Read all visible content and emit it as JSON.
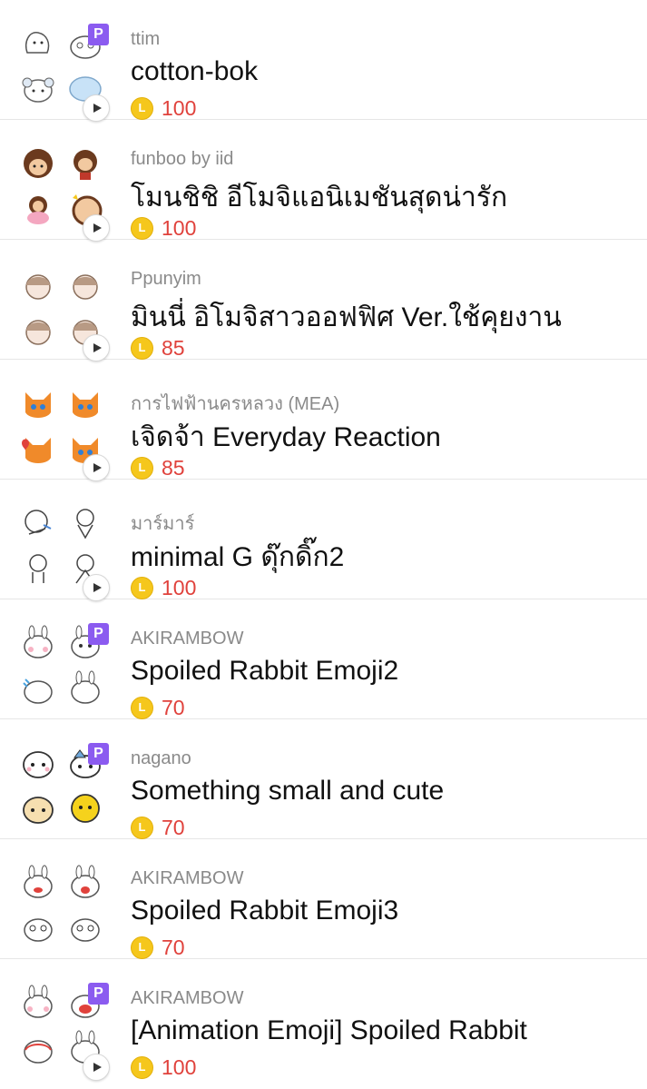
{
  "items": [
    {
      "author": "ttim",
      "title": "cotton-bok",
      "price": "100",
      "premium_badge": "P",
      "has_premium": true,
      "animated": true
    },
    {
      "author": "funboo by iid",
      "title": "โมนชิชิ อีโมจิแอนิเมชันสุดน่ารัก",
      "price": "100",
      "premium_badge": "",
      "has_premium": false,
      "animated": true
    },
    {
      "author": "Ppunyim",
      "title": "มินนี่ อิโมจิสาวออฟฟิศ Ver.ใช้คุยงาน",
      "price": "85",
      "premium_badge": "",
      "has_premium": false,
      "animated": true
    },
    {
      "author": "การไฟฟ้านครหลวง (MEA)",
      "title": "เจิดจ้า Everyday Reaction",
      "price": "85",
      "premium_badge": "",
      "has_premium": false,
      "animated": true
    },
    {
      "author": "มาร์มาร์",
      "title": "minimal G ดุ๊กดิ๊ก2",
      "price": "100",
      "premium_badge": "",
      "has_premium": false,
      "animated": true
    },
    {
      "author": "AKIRAMBOW",
      "title": "Spoiled Rabbit Emoji2",
      "price": "70",
      "premium_badge": "P",
      "has_premium": true,
      "animated": false
    },
    {
      "author": "nagano",
      "title": "Something small and cute",
      "price": "70",
      "premium_badge": "P",
      "has_premium": true,
      "animated": false
    },
    {
      "author": "AKIRAMBOW",
      "title": "Spoiled Rabbit Emoji3",
      "price": "70",
      "premium_badge": "",
      "has_premium": false,
      "animated": false
    },
    {
      "author": "AKIRAMBOW",
      "title": "[Animation Emoji] Spoiled Rabbit",
      "price": "100",
      "premium_badge": "P",
      "has_premium": true,
      "animated": true
    }
  ],
  "coin_letter": "L",
  "colors": {
    "price": "#e0423c",
    "premium_badge": "#8b5bf0",
    "coin": "#f5c71c",
    "divider": "#e6e6e6"
  },
  "icons": [
    "emoji-pack-thumbnail",
    "premium-badge",
    "play-icon",
    "line-coin-icon"
  ]
}
